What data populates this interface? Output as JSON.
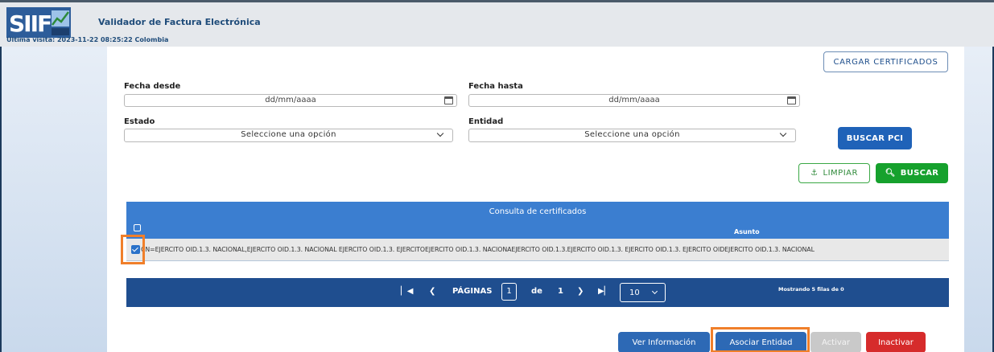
{
  "header": {
    "logo_text": "SIIF Nación",
    "app_title": "Validador de Factura Electrónica",
    "last_visit": "Última visita: 2023-11-22 08:25:22 Colombia"
  },
  "actions": {
    "cargar_label": "CARGAR CERTIFICADOS",
    "buscar_pci_label": "BUSCAR PCI",
    "limpiar_label": "LIMPIAR",
    "buscar_label": "BUSCAR"
  },
  "filters": {
    "fecha_desde_label": "Fecha desde",
    "fecha_desde_placeholder": "dd/mm/aaaa",
    "fecha_hasta_label": "Fecha hasta",
    "fecha_hasta_placeholder": "dd/mm/aaaa",
    "estado_label": "Estado",
    "estado_value": "Seleccione una opción",
    "entidad_label": "Entidad",
    "entidad_value": "Seleccione una opción"
  },
  "table": {
    "title": "Consulta de certificados",
    "column_asunto": "Asunto",
    "rows": [
      {
        "selected": true,
        "asunto": "CN=EJERCITO OID.1.3. NACIONAL,EJERCITO OID.1.3. NACIONAL EJERCITO OID.1.3. EJERCITOEJERCITO OID.1.3. NACIONAEJERCITO OID.1.3.EJERCITO OID.1.3. EJERCITO OID.1.3. EJERCITO OIDEJERCITO OID.1.3. NACIONAL"
      }
    ]
  },
  "pagination": {
    "paginas_label": "PÁGINAS",
    "current_page": "1",
    "de_label": "de",
    "total_pages": "1",
    "page_size": "10",
    "info": "Mostrando 5 filas de 0"
  },
  "bottom_actions": {
    "ver_label": "Ver Información",
    "asociar_label": "Asociar Entidad",
    "activar_label": "Activar",
    "inactivar_label": "Inactivar"
  },
  "colors": {
    "primary": "#1f62b8",
    "table_header": "#3b7ed0",
    "pager": "#1f4e8f",
    "success": "#16a12d",
    "danger": "#d62b2b",
    "highlight": "#f07f2a"
  }
}
